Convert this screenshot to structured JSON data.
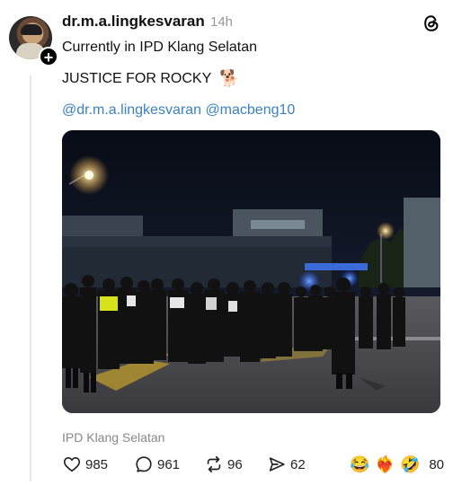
{
  "post": {
    "username": "dr.m.a.lingkesvaran",
    "time": "14h",
    "line1": "Currently in IPD Klang Selatan",
    "line2": "JUSTICE FOR ROCKY",
    "line2_emoji": "🐕",
    "mentions": [
      "@dr.m.a.lingkesvaran",
      "@macbeng10"
    ],
    "location": "IPD Klang Selatan",
    "plus": "+"
  },
  "actions": {
    "likes": "985",
    "comments": "961",
    "reposts": "96",
    "shares": "62",
    "reaction_count": "80"
  },
  "reactions": [
    "😂",
    "❤️‍🔥",
    "🤣"
  ],
  "icons": {
    "like": "heart-icon",
    "comment": "comment-icon",
    "repost": "repost-icon",
    "share": "share-icon",
    "app": "threads-logo-icon"
  }
}
